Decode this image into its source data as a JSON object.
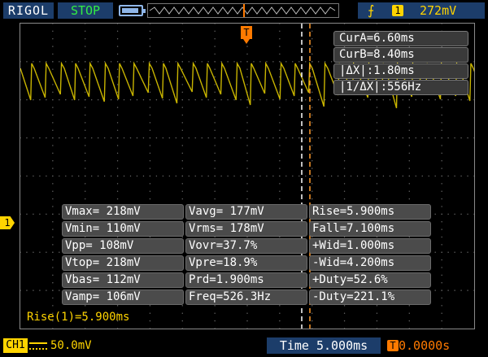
{
  "header": {
    "brand": "RIGOL",
    "run_state": "STOP",
    "trigger_channel": "1",
    "trigger_level": "272mV",
    "trigger_position_marker": "T"
  },
  "cursors": {
    "readouts": [
      "CurA=6.60ms",
      "CurB=8.40ms",
      "|ΔX|:1.80ms",
      "|1/ΔX|:556Hz"
    ]
  },
  "measurements": {
    "rows": [
      [
        "Vmax= 218mV",
        "Vavg= 177mV",
        "Rise=5.900ms"
      ],
      [
        "Vmin= 110mV",
        "Vrms= 178mV",
        "Fall=7.100ms"
      ],
      [
        "Vpp= 108mV",
        "Vovr=37.7%",
        "+Wid=1.000ms"
      ],
      [
        "Vtop= 218mV",
        "Vpre=18.9%",
        "-Wid=4.200ms"
      ],
      [
        "Vbas= 112mV",
        "Prd=1.900ms",
        "+Duty=52.6%"
      ],
      [
        "Vamp= 106mV",
        "Freq=526.3Hz",
        "-Duty=221.1%"
      ]
    ],
    "highlight": "Rise(1)=5.900ms"
  },
  "channel": {
    "badge": "CH1",
    "scale": "50.0mV",
    "marker": "1"
  },
  "timebase": {
    "label": "Time 5.000ms",
    "offset_icon": "T",
    "offset": "0.0000s"
  },
  "colors": {
    "trace": "#c8b400",
    "cursor": "#ff9a2a",
    "accent": "#ffd400"
  },
  "icons": {
    "battery": "battery-icon",
    "trigger_edge": "rising-edge-icon"
  }
}
